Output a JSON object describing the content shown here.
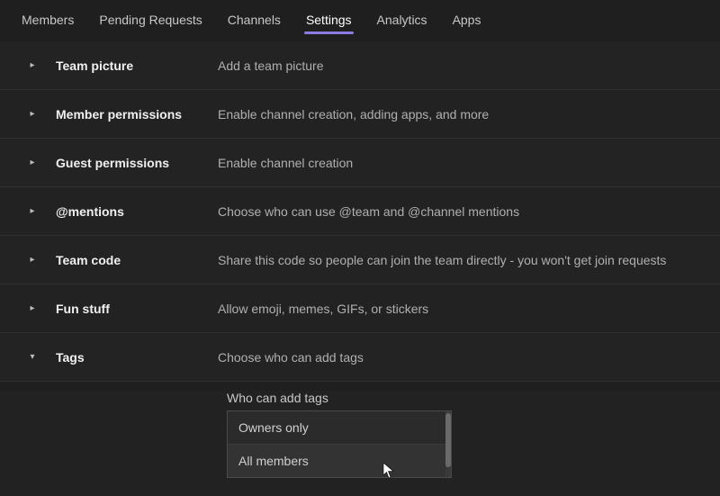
{
  "tabs": [
    {
      "label": "Members",
      "active": false
    },
    {
      "label": "Pending Requests",
      "active": false
    },
    {
      "label": "Channels",
      "active": false
    },
    {
      "label": "Settings",
      "active": true
    },
    {
      "label": "Analytics",
      "active": false
    },
    {
      "label": "Apps",
      "active": false
    }
  ],
  "settings": {
    "rows": [
      {
        "title": "Team picture",
        "desc": "Add a team picture",
        "expanded": false
      },
      {
        "title": "Member permissions",
        "desc": "Enable channel creation, adding apps, and more",
        "expanded": false
      },
      {
        "title": "Guest permissions",
        "desc": "Enable channel creation",
        "expanded": false
      },
      {
        "title": "@mentions",
        "desc": "Choose who can use @team and @channel mentions",
        "expanded": false
      },
      {
        "title": "Team code",
        "desc": "Share this code so people can join the team directly - you won't get join requests",
        "expanded": false
      },
      {
        "title": "Fun stuff",
        "desc": "Allow emoji, memes, GIFs, or stickers",
        "expanded": false
      },
      {
        "title": "Tags",
        "desc": "Choose who can add tags",
        "expanded": true
      }
    ],
    "tags": {
      "field_label": "Who can add tags",
      "options": [
        "Owners only",
        "All members"
      ]
    }
  }
}
